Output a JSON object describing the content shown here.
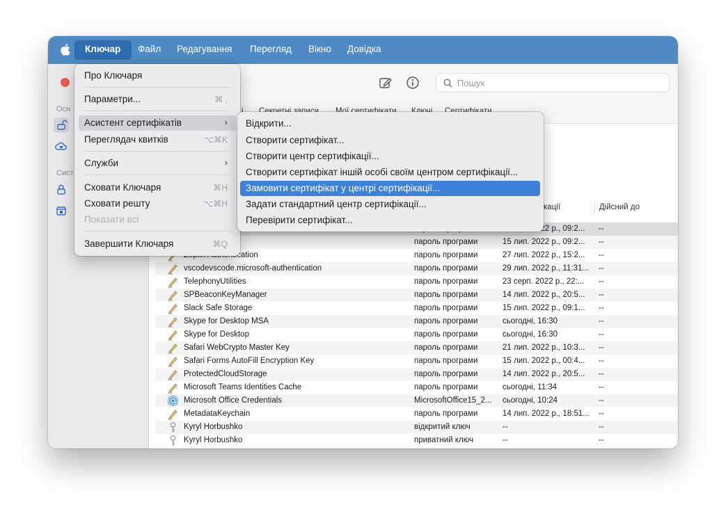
{
  "menubar": {
    "items": [
      "Ключар",
      "Файл",
      "Редагування",
      "Перегляд",
      "Вікно",
      "Довідка"
    ]
  },
  "toolbar": {
    "search_placeholder": "Пошук"
  },
  "sidebar": {
    "heading1": "Осн",
    "heading2": "Сист"
  },
  "tabs": [
    "і",
    "Секретні записи",
    "Мої сертифікати",
    "Ключі",
    "Сертифікати"
  ],
  "columns": {
    "date": "фікації",
    "expires": "Дійсний до"
  },
  "rows": [
    {
      "name": "…ge",
      "kind": "пароль програми",
      "date": "15 лип. 2022 р., 09:2...",
      "expires": "--",
      "icon": "pencil-icon"
    },
    {
      "name": "…eting Storage",
      "kind": "пароль програми",
      "date": "15 лип. 2022 р., 09:2...",
      "expires": "--",
      "icon": "pencil-icon"
    },
    {
      "name": "Zeplin Authentication",
      "kind": "пароль програми",
      "date": "27 лип. 2022 р., 15:2...",
      "expires": "--",
      "icon": "pencil-icon"
    },
    {
      "name": "vscodevscode.microsoft-authentication",
      "kind": "пароль програми",
      "date": "29 лип. 2022 р., 11:31...",
      "expires": "--",
      "icon": "pencil-icon"
    },
    {
      "name": "TelephonyUtilities",
      "kind": "пароль програми",
      "date": "23 серп. 2022 р., 22:...",
      "expires": "--",
      "icon": "pencil-icon"
    },
    {
      "name": "SPBeaconKeyManager",
      "kind": "пароль програми",
      "date": "14 лип. 2022 р., 20:5...",
      "expires": "--",
      "icon": "pencil-icon"
    },
    {
      "name": "Slack Safe Storage",
      "kind": "пароль програми",
      "date": "15 лип. 2022 р., 09:1...",
      "expires": "--",
      "icon": "pencil-icon"
    },
    {
      "name": "Skype for Desktop MSA",
      "kind": "пароль програми",
      "date": "сьогодні, 16:30",
      "expires": "--",
      "icon": "pencil-icon"
    },
    {
      "name": "Skype for Desktop",
      "kind": "пароль програми",
      "date": "сьогодні, 16:30",
      "expires": "--",
      "icon": "pencil-icon"
    },
    {
      "name": "Safari WebCrypto Master Key",
      "kind": "пароль програми",
      "date": "21 лип. 2022 р., 10:3...",
      "expires": "--",
      "icon": "pencil-icon"
    },
    {
      "name": "Safari Forms AutoFill Encryption Key",
      "kind": "пароль програми",
      "date": "15 лип. 2022 р., 00:4...",
      "expires": "--",
      "icon": "pencil-icon"
    },
    {
      "name": "ProtectedCloudStorage",
      "kind": "пароль програми",
      "date": "14 лип. 2022 р., 20:5...",
      "expires": "--",
      "icon": "pencil-icon"
    },
    {
      "name": "Microsoft Teams Identities Cache",
      "kind": "пароль програми",
      "date": "сьогодні, 11:34",
      "expires": "--",
      "icon": "pencil-icon"
    },
    {
      "name": "Microsoft Office Credentials",
      "kind": "MicrosoftOffice15_2...",
      "date": "сьогодні, 10:24",
      "expires": "--",
      "icon": "at-sign-icon"
    },
    {
      "name": "MetadataKeychain",
      "kind": "пароль програми",
      "date": "14 лип. 2022 р., 18:51...",
      "expires": "--",
      "icon": "pencil-icon"
    },
    {
      "name": "Kyryl Horbushko",
      "kind": "відкритий ключ",
      "date": "--",
      "expires": "--",
      "icon": "key-icon"
    },
    {
      "name": "Kyryl Horbushko",
      "kind": "приватний ключ",
      "date": "--",
      "expires": "--",
      "icon": "key-icon"
    }
  ],
  "app_menu": {
    "about": "Про Ключаря",
    "settings": "Параметри...",
    "settings_shortcut": "⌘ ,",
    "cert_assistant": "Асистент сертифікатів",
    "ticket_viewer": "Переглядач квитків",
    "ticket_viewer_shortcut": "⌥⌘K",
    "services": "Служби",
    "hide": "Сховати Ключаря",
    "hide_shortcut": "⌘H",
    "hide_others": "Сховати решту",
    "hide_others_shortcut": "⌥⌘H",
    "show_all": "Показати всі",
    "quit": "Завершити Ключаря",
    "quit_shortcut": "⌘Q"
  },
  "submenu": {
    "open": "Відкрити...",
    "create_cert": "Створити сертифікат...",
    "create_ca": "Створити центр сертифікації...",
    "create_for_other": "Створити сертифікат іншій особі своїм центром сертифікації...",
    "request_from_ca": "Замовити сертифікат у центрі сертифікації...",
    "set_default_ca": "Задати стандартний центр сертифікації...",
    "verify": "Перевірити сертифікат..."
  },
  "colors": {
    "menubar": "#4f8ac4",
    "menu_highlight_blue": "#3d82d9",
    "close_button": "#ee5a52"
  }
}
